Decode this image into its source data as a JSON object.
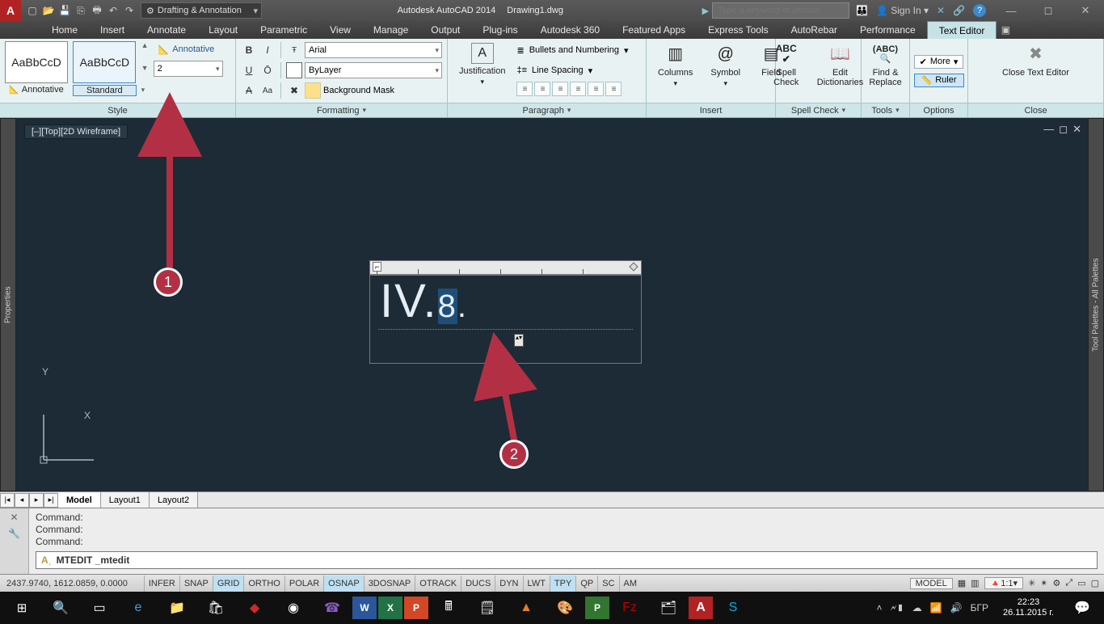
{
  "titlebar": {
    "workspace": "Drafting & Annotation",
    "app_name": "Autodesk AutoCAD 2014",
    "file_name": "Drawing1.dwg",
    "search_placeholder": "Type a keyword or phrase",
    "sign_in": "Sign In"
  },
  "menubar": {
    "items": [
      "Home",
      "Insert",
      "Annotate",
      "Layout",
      "Parametric",
      "View",
      "Manage",
      "Output",
      "Plug-ins",
      "Autodesk 360",
      "Featured Apps",
      "Express Tools",
      "AutoRebar",
      "Performance",
      "Text Editor"
    ],
    "active": "Text Editor"
  },
  "ribbon": {
    "style": {
      "sample": "AaBbCcD",
      "annotative": "Annotative",
      "standard": "Standard",
      "annotative_link": "Annotative",
      "height_value": "2",
      "label": "Style"
    },
    "formatting": {
      "font": "Arial",
      "layer": "ByLayer",
      "bg_mask": "Background Mask",
      "label": "Formatting"
    },
    "paragraph": {
      "justification": "Justification",
      "bullets": "Bullets and Numbering",
      "line_spacing": "Line Spacing",
      "label": "Paragraph"
    },
    "insert": {
      "columns": "Columns",
      "symbol": "Symbol",
      "field": "Field",
      "label": "Insert"
    },
    "spell": {
      "spell": "Spell\nCheck",
      "dict": "Edit\nDictionaries",
      "label": "Spell Check"
    },
    "tools": {
      "find": "Find &\nReplace",
      "label": "Tools"
    },
    "options": {
      "more": "More",
      "ruler": "Ruler",
      "label": "Options"
    },
    "close": {
      "btn": "Close Text Editor",
      "label": "Close"
    }
  },
  "view": {
    "label": "[–][Top][2D Wireframe]"
  },
  "mtext": {
    "content_big": "IV.",
    "content_sel": "8",
    "content_after": "."
  },
  "layout_tabs": {
    "tabs": [
      "Model",
      "Layout1",
      "Layout2"
    ],
    "active": "Model"
  },
  "command": {
    "history": [
      "Command:",
      "Command:",
      "Command:"
    ],
    "current": "MTEDIT _mtedit"
  },
  "status": {
    "coords": "2437.9740, 1612.0859, 0.0000",
    "toggles": [
      {
        "t": "INFER",
        "on": false
      },
      {
        "t": "SNAP",
        "on": false
      },
      {
        "t": "GRID",
        "on": true
      },
      {
        "t": "ORTHO",
        "on": false
      },
      {
        "t": "POLAR",
        "on": false
      },
      {
        "t": "OSNAP",
        "on": true
      },
      {
        "t": "3DOSNAP",
        "on": false
      },
      {
        "t": "OTRACK",
        "on": false
      },
      {
        "t": "DUCS",
        "on": false
      },
      {
        "t": "DYN",
        "on": false
      },
      {
        "t": "LWT",
        "on": false
      },
      {
        "t": "TPY",
        "on": true
      },
      {
        "t": "QP",
        "on": false
      },
      {
        "t": "SC",
        "on": false
      },
      {
        "t": "AM",
        "on": false
      }
    ],
    "model": "MODEL",
    "scale": "1:1"
  },
  "taskbar": {
    "lang": "БГР",
    "time": "22:23",
    "date": "26.11.2015 г."
  },
  "annotations": {
    "c1": "1",
    "c2": "2"
  }
}
